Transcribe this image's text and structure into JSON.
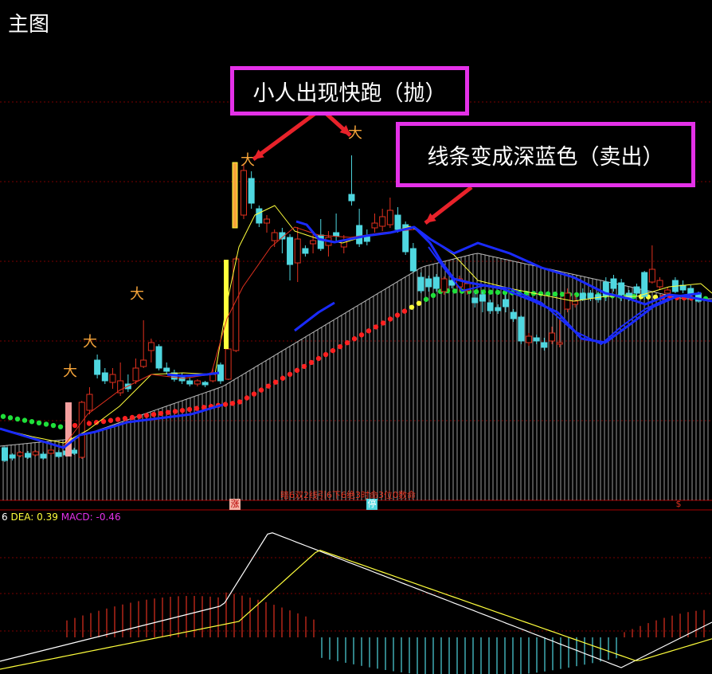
{
  "panel_title": "主图",
  "callouts": {
    "runner": "小人出现快跑（抛）",
    "blue_line": "线条变成深蓝色（卖出）"
  },
  "scroll_text": "暗6双2线引6下6绝3时命3位0数命",
  "markers": {
    "m1": "涨",
    "m2": "停",
    "m3": "$"
  },
  "macd_legend": {
    "dif": "6",
    "dea": "DEA: 0.39",
    "macd": "MACD: -0.46"
  },
  "colors": {
    "up": "#e0301e",
    "down": "#4fd7e0",
    "callout_border": "#e431e8",
    "blue_line": "#1a2bff",
    "runner": "#f7a53a",
    "yellow": "#ffff3c",
    "grid": "#7a0000"
  },
  "chart_data": {
    "type": "candlestick",
    "candles": [
      [
        562,
        578,
        560,
        580,
        "d"
      ],
      [
        575,
        571,
        569,
        578,
        "d"
      ],
      [
        572,
        568,
        566,
        574,
        "u"
      ],
      [
        569,
        574,
        566,
        576,
        "d"
      ],
      [
        571,
        567,
        565,
        573,
        "u"
      ],
      [
        570,
        575,
        567,
        577,
        "d"
      ],
      [
        569,
        565,
        563,
        571,
        "u"
      ],
      [
        568,
        573,
        565,
        575,
        "d"
      ],
      [
        566,
        571,
        563,
        573,
        "d"
      ],
      [
        565,
        569,
        562,
        571,
        "d"
      ],
      [
        574,
        505,
        503,
        576,
        "u"
      ],
      [
        515,
        495,
        486,
        520,
        "u"
      ],
      [
        452,
        470,
        445,
        475,
        "d"
      ],
      [
        468,
        478,
        462,
        482,
        "d"
      ],
      [
        480,
        470,
        462,
        488,
        "u"
      ],
      [
        493,
        478,
        455,
        497,
        "u"
      ],
      [
        488,
        482,
        470,
        492,
        "d"
      ],
      [
        478,
        462,
        450,
        482,
        "u"
      ],
      [
        460,
        452,
        402,
        462,
        "u"
      ],
      [
        440,
        430,
        425,
        455,
        "u"
      ],
      [
        435,
        462,
        432,
        465,
        "d"
      ],
      [
        462,
        466,
        455,
        470,
        "d"
      ],
      [
        468,
        476,
        464,
        479,
        "d"
      ],
      [
        474,
        478,
        468,
        482,
        "d"
      ],
      [
        478,
        482,
        474,
        485,
        "d"
      ],
      [
        482,
        478,
        476,
        485,
        "u"
      ],
      [
        480,
        483,
        478,
        486,
        "d"
      ],
      [
        478,
        468,
        462,
        480,
        "u"
      ],
      [
        458,
        478,
        455,
        482,
        "d"
      ],
      [
        476,
        438,
        425,
        477,
        "u"
      ],
      [
        440,
        325,
        322,
        442,
        "u"
      ],
      [
        270,
        214,
        205,
        275,
        "u"
      ],
      [
        224,
        255,
        215,
        262,
        "d"
      ],
      [
        262,
        280,
        258,
        285,
        "d"
      ],
      [
        280,
        275,
        270,
        292,
        "u"
      ],
      [
        302,
        292,
        288,
        310,
        "u"
      ],
      [
        292,
        300,
        286,
        318,
        "d"
      ],
      [
        298,
        332,
        294,
        352,
        "d"
      ],
      [
        300,
        330,
        285,
        354,
        "u"
      ],
      [
        312,
        318,
        308,
        322,
        "d"
      ],
      [
        302,
        306,
        290,
        318,
        "u"
      ],
      [
        295,
        312,
        275,
        315,
        "d"
      ],
      [
        308,
        298,
        290,
        322,
        "u"
      ],
      [
        292,
        296,
        268,
        302,
        "d"
      ],
      [
        302,
        310,
        295,
        318,
        "u"
      ],
      [
        252,
        244,
        195,
        258,
        "d"
      ],
      [
        283,
        306,
        262,
        310,
        "d"
      ],
      [
        296,
        303,
        288,
        308,
        "d"
      ],
      [
        280,
        286,
        268,
        292,
        "u"
      ],
      [
        272,
        284,
        262,
        290,
        "u"
      ],
      [
        264,
        282,
        248,
        286,
        "u"
      ],
      [
        270,
        288,
        260,
        292,
        "d"
      ],
      [
        282,
        316,
        278,
        320,
        "d"
      ],
      [
        312,
        340,
        305,
        342,
        "d"
      ],
      [
        348,
        365,
        342,
        368,
        "d"
      ],
      [
        350,
        360,
        346,
        366,
        "d"
      ],
      [
        348,
        362,
        344,
        366,
        "d"
      ],
      [
        350,
        366,
        347,
        370,
        "u"
      ],
      [
        352,
        358,
        350,
        362,
        "d"
      ],
      [
        350,
        360,
        346,
        366,
        "u"
      ],
      [
        356,
        365,
        352,
        370,
        "u"
      ],
      [
        374,
        380,
        368,
        386,
        "d"
      ],
      [
        370,
        378,
        366,
        392,
        "d"
      ],
      [
        380,
        390,
        376,
        394,
        "d"
      ],
      [
        386,
        390,
        382,
        394,
        "d"
      ],
      [
        376,
        385,
        370,
        392,
        "d"
      ],
      [
        392,
        400,
        388,
        404,
        "d"
      ],
      [
        398,
        428,
        396,
        432,
        "d"
      ],
      [
        422,
        430,
        418,
        434,
        "u"
      ],
      [
        424,
        428,
        420,
        432,
        "d"
      ],
      [
        430,
        436,
        424,
        440,
        "d"
      ],
      [
        418,
        428,
        410,
        432,
        "u"
      ],
      [
        430,
        432,
        400,
        436,
        "u"
      ],
      [
        368,
        388,
        362,
        392,
        "u"
      ],
      [
        378,
        382,
        370,
        386,
        "u"
      ],
      [
        368,
        376,
        362,
        378,
        "d"
      ],
      [
        368,
        374,
        364,
        378,
        "d"
      ],
      [
        370,
        376,
        366,
        380,
        "d"
      ],
      [
        354,
        372,
        348,
        378,
        "d"
      ],
      [
        350,
        362,
        345,
        366,
        "d"
      ],
      [
        355,
        370,
        350,
        378,
        "d"
      ],
      [
        368,
        374,
        364,
        378,
        "d"
      ],
      [
        360,
        368,
        356,
        372,
        "d"
      ],
      [
        342,
        372,
        340,
        376,
        "d"
      ],
      [
        338,
        354,
        308,
        356,
        "u"
      ],
      [
        352,
        360,
        348,
        364,
        "u"
      ],
      [
        364,
        368,
        360,
        372,
        "u"
      ],
      [
        352,
        366,
        348,
        368,
        "d"
      ],
      [
        358,
        364,
        352,
        368,
        "d"
      ],
      [
        362,
        370,
        358,
        374,
        "d"
      ],
      [
        368,
        378,
        366,
        380,
        "d"
      ]
    ]
  }
}
